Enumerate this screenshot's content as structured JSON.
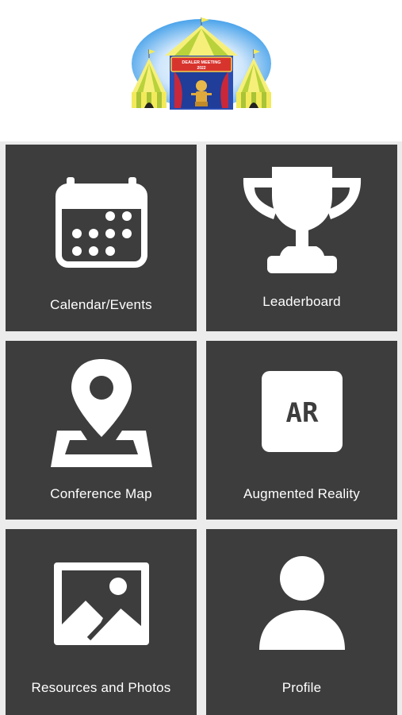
{
  "app": {
    "logo": {
      "icon": "circus-tent-logo",
      "banner_line1": "DEALER MEETING",
      "banner_line2": "2022"
    }
  },
  "menu": {
    "tiles": [
      {
        "label": "Calendar/Events",
        "icon": "calendar-icon"
      },
      {
        "label": "Leaderboard",
        "icon": "trophy-icon"
      },
      {
        "label": "Conference Map",
        "icon": "map-pin-icon"
      },
      {
        "label": "Augmented Reality",
        "icon": "ar-icon",
        "icon_text": "AR"
      },
      {
        "label": "Resources and Photos",
        "icon": "image-icon"
      },
      {
        "label": "Profile",
        "icon": "profile-icon"
      }
    ]
  },
  "colors": {
    "tile_background": "#3d3d3d",
    "grid_gap": "#ececec",
    "icon": "#ffffff"
  }
}
